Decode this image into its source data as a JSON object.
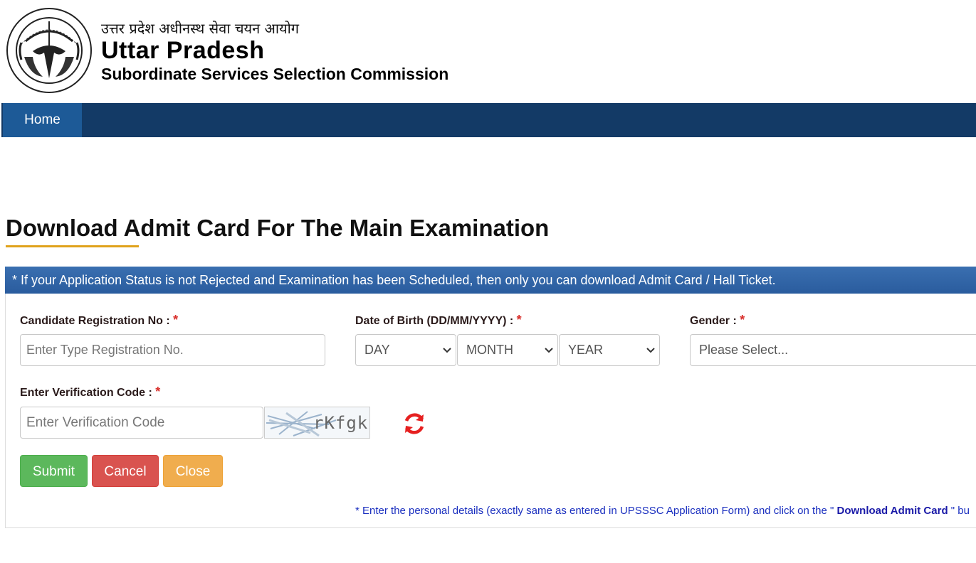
{
  "header": {
    "hindi_title": "उत्तर प्रदेश अधीनस्थ सेवा चयन आयोग",
    "org_line1": "Uttar Pradesh",
    "org_line2": "Subordinate Services Selection Commission",
    "emblem_icon": "up-state-emblem-icon"
  },
  "nav": {
    "home_label": "Home"
  },
  "page": {
    "title": "Download Admit Card For The Main Examination",
    "notice": "* If your Application Status is not Rejected and Examination has been Scheduled, then only you can download Admit Card / Hall Ticket."
  },
  "form": {
    "registration_label": "Candidate Registration No :",
    "registration_placeholder": "Enter Type Registration No.",
    "dob_label": "Date of Birth (DD/MM/YYYY) :",
    "dob_day": "DAY",
    "dob_month": "MONTH",
    "dob_year": "YEAR",
    "gender_label": "Gender :",
    "gender_placeholder": "Please Select...",
    "verification_label": "Enter Verification Code :",
    "verification_placeholder": "Enter Verification Code",
    "captcha_text": "rKfgk",
    "required_mark": "*",
    "refresh_icon": "refresh-icon"
  },
  "buttons": {
    "submit": "Submit",
    "cancel": "Cancel",
    "close": "Close"
  },
  "footnote": {
    "prefix": "* Enter the personal details (exactly same as entered in UPSSSC Application Form) and click on the \"",
    "link": "Download Admit Card",
    "suffix": "\" bu"
  },
  "colors": {
    "navbar": "#133a66",
    "nav_active": "#1d5a97",
    "notice": "#2a5c9e",
    "submit": "#5cb85c",
    "cancel": "#d9534f",
    "close": "#f0ad4e",
    "accent_underline": "#e0a21b"
  }
}
